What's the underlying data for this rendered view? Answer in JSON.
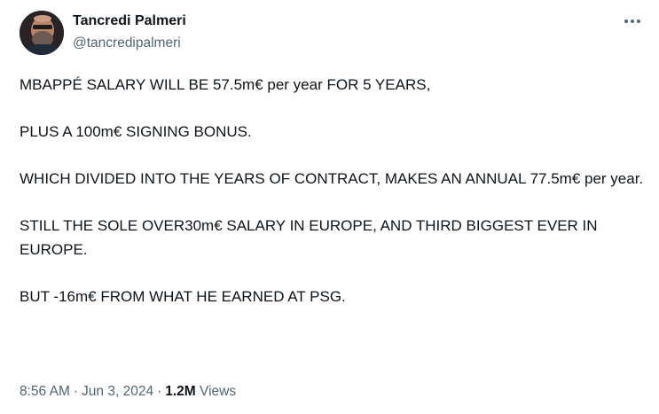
{
  "author": {
    "display_name": "Tancredi Palmeri",
    "handle": "@tancredipalmeri"
  },
  "header": {
    "more_icon": "more-horizontal-icon"
  },
  "tweet": {
    "lines": [
      "MBAPPÉ SALARY WILL BE 57.5m€ per year FOR 5 YEARS,",
      "PLUS A 100m€ SIGNING BONUS.",
      "WHICH DIVIDED INTO THE YEARS OF CONTRACT, MAKES AN ANNUAL 77.5m€ per year.",
      "STILL THE SOLE OVER30m€ SALARY IN EUROPE, AND THIRD BIGGEST EVER IN EUROPE.",
      "BUT -16m€ FROM WHAT HE EARNED AT PSG."
    ]
  },
  "meta": {
    "time": "8:56 AM",
    "separator": "·",
    "date": "Jun 3, 2024",
    "views_count": "1.2M",
    "views_label": "Views"
  },
  "colors": {
    "text_primary": "#0f1419",
    "text_secondary": "#536471",
    "background": "#ffffff"
  }
}
